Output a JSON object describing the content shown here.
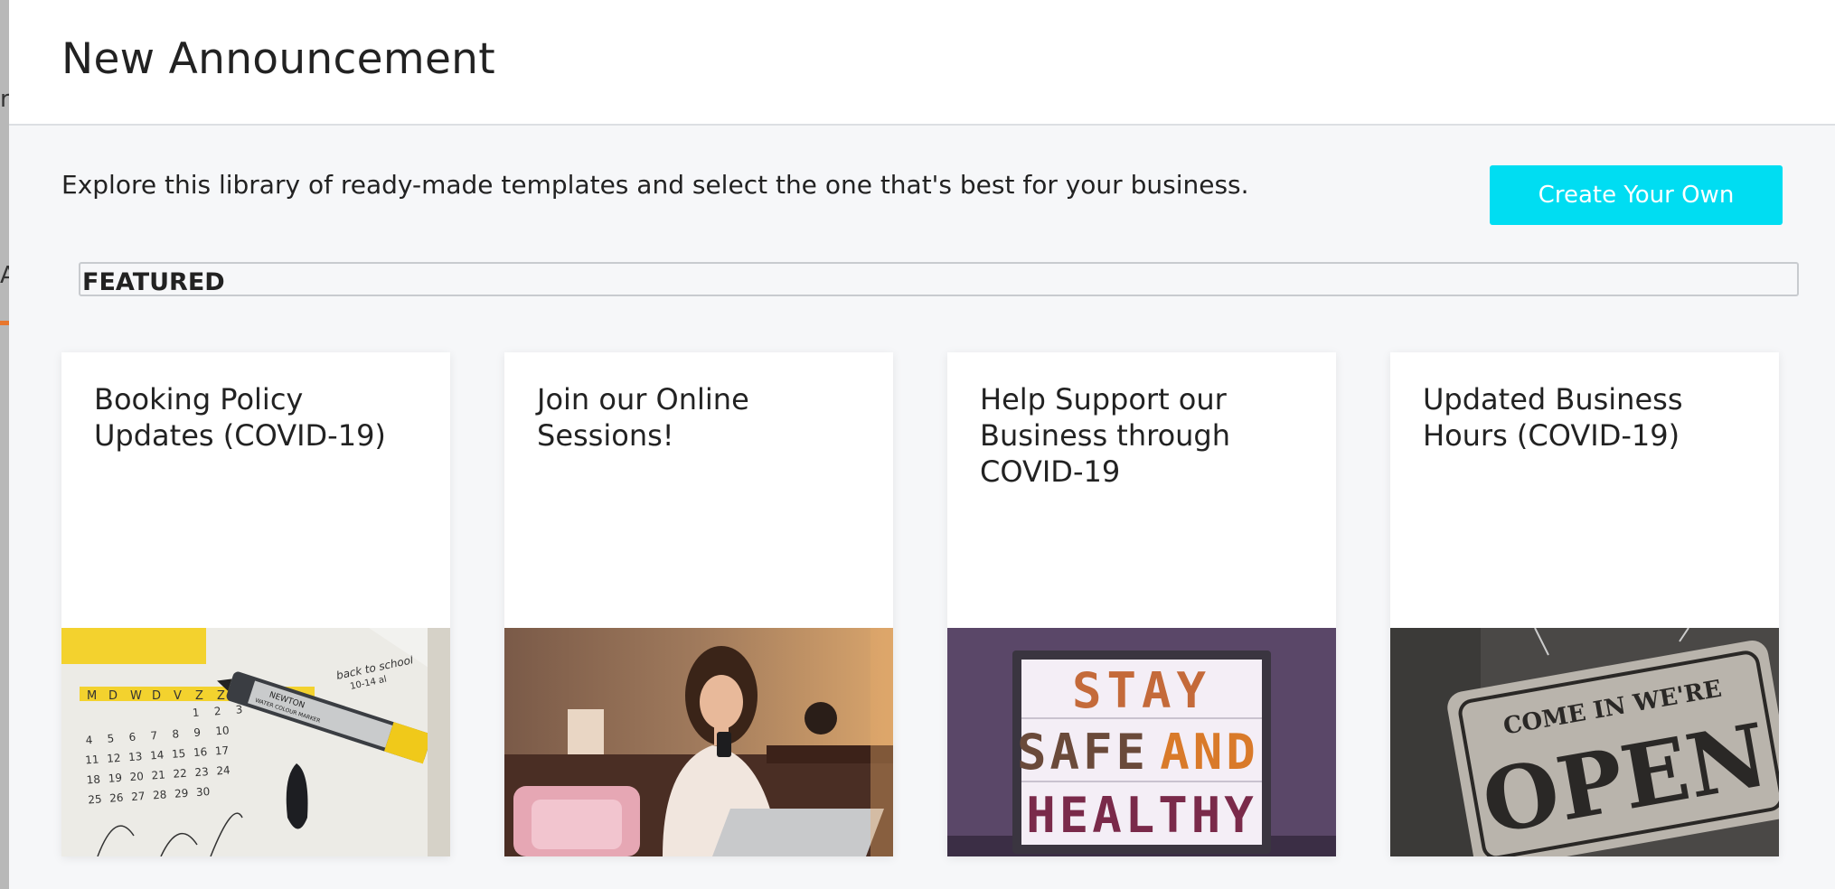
{
  "backdrop": {
    "chars": [
      "r",
      "A"
    ],
    "accent_color": "#e8762c"
  },
  "modal": {
    "title": "New Announcement",
    "intro": "Explore this library of ready-made templates and select the one that's best for your business.",
    "create_button": "Create Your Own",
    "section_label": "FEATURED",
    "accent_color": "#00ddf2"
  },
  "templates": [
    {
      "title": "Booking Policy Updates (COVID-19)",
      "image": "calendar-marker-photo",
      "image_text": {
        "days": [
          "M",
          "D",
          "W",
          "D",
          "V",
          "Z",
          "Z"
        ],
        "row1": [
          "1",
          "2",
          "3"
        ],
        "row2": [
          "4",
          "5",
          "6",
          "7",
          "8",
          "9",
          "10"
        ],
        "row3": [
          "11",
          "12",
          "13",
          "14",
          "15",
          "16",
          "17"
        ],
        "row4": [
          "18",
          "19",
          "20",
          "21",
          "22",
          "23",
          "24"
        ],
        "row5": [
          "25",
          "26",
          "27",
          "28",
          "29",
          "30"
        ],
        "note": "back to school",
        "note2": "10-14 al",
        "marker": "NEWTON",
        "marker2": "WATER COLOUR MARKER"
      }
    },
    {
      "title": "Join our Online Sessions!",
      "image": "woman-with-phone-photo"
    },
    {
      "title": "Help Support our Business through COVID-19",
      "image": "lightbox-sign-photo",
      "image_text": {
        "line1": "STAY",
        "line2a": "SAFE",
        "line2b": "AND",
        "line3": "HEALTHY"
      }
    },
    {
      "title": "Updated Business Hours (COVID-19)",
      "image": "open-sign-photo",
      "image_text": {
        "top": "COME IN WE'RE",
        "main": "OPEN"
      }
    }
  ]
}
